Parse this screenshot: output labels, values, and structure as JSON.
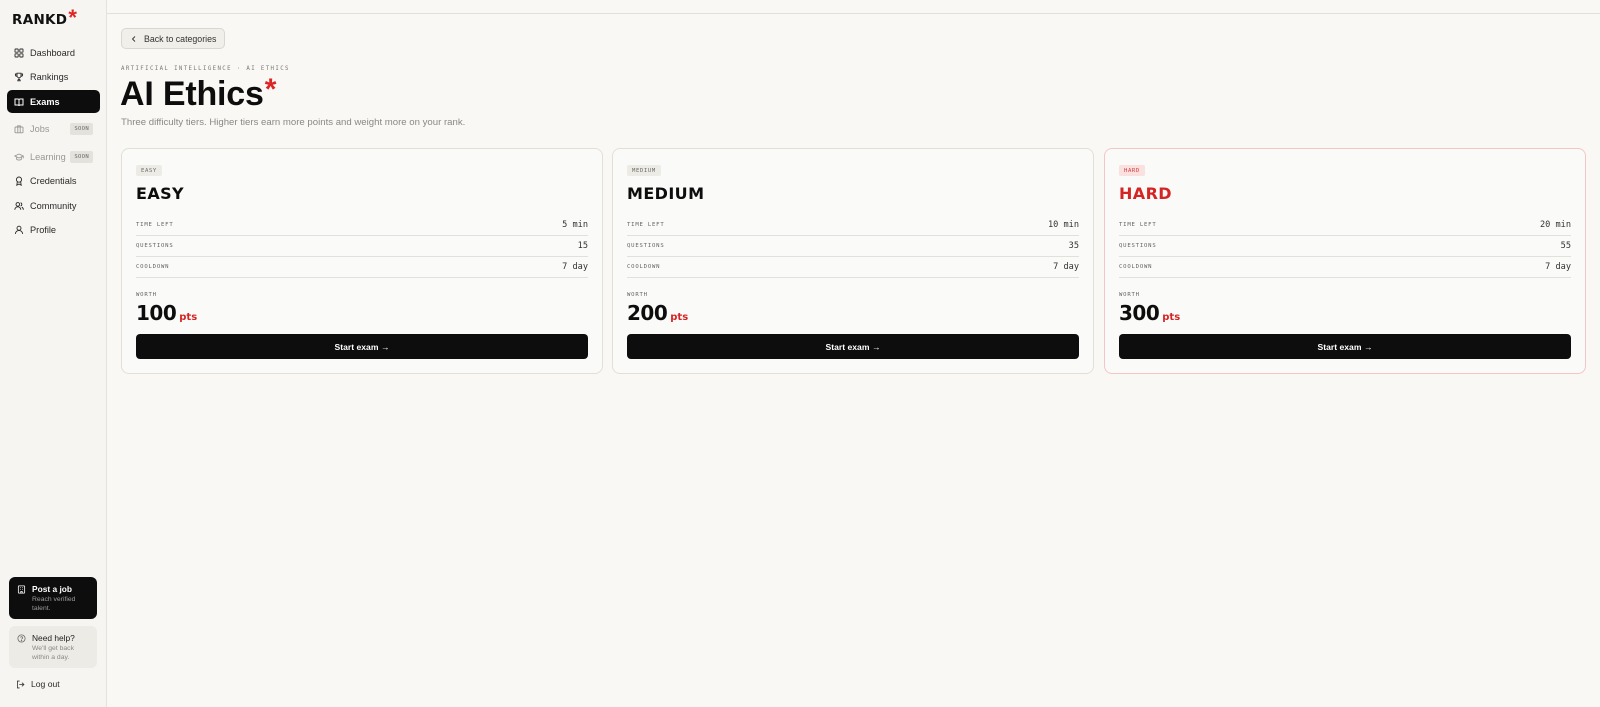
{
  "app": {
    "logo_text": "RANKD",
    "logo_mark": "*"
  },
  "sidebar": {
    "items": [
      {
        "label": "Dashboard",
        "icon": "grid-icon"
      },
      {
        "label": "Rankings",
        "icon": "trophy-icon"
      },
      {
        "label": "Exams",
        "icon": "book-icon",
        "active": true
      },
      {
        "label": "Jobs",
        "icon": "briefcase-icon",
        "badge": "SOON",
        "disabled": true
      },
      {
        "label": "Learning",
        "icon": "graduation-cap-icon",
        "badge": "SOON",
        "disabled": true
      },
      {
        "label": "Credentials",
        "icon": "award-icon"
      },
      {
        "label": "Community",
        "icon": "users-icon"
      },
      {
        "label": "Profile",
        "icon": "user-icon"
      }
    ],
    "post_job": {
      "title": "Post a job",
      "subtitle": "Reach verified talent."
    },
    "help": {
      "title": "Need help?",
      "subtitle": "We'll get back within a day."
    },
    "logout_label": "Log out"
  },
  "main": {
    "back_label": "Back to categories",
    "breadcrumb": "ARTIFICIAL INTELLIGENCE · AI ETHICS",
    "title": "AI Ethics",
    "title_mark": "*",
    "subtitle": "Three difficulty tiers. Higher tiers earn more points and weight more on your rank.",
    "row_labels": {
      "time": "TIME LEFT",
      "questions": "QUESTIONS",
      "cooldown": "COOLDOWN",
      "worth": "WORTH"
    },
    "tiers": [
      {
        "badge": "EASY",
        "name": "EASY",
        "time": "5 min",
        "questions": "15",
        "cooldown": "7 day",
        "worth": "100",
        "unit": "pts",
        "cta": "Start exam →"
      },
      {
        "badge": "MEDIUM",
        "name": "MEDIUM",
        "time": "10 min",
        "questions": "35",
        "cooldown": "7 day",
        "worth": "200",
        "unit": "pts",
        "cta": "Start exam →"
      },
      {
        "badge": "HARD",
        "name": "HARD",
        "time": "20 min",
        "questions": "55",
        "cooldown": "7 day",
        "worth": "300",
        "unit": "pts",
        "cta": "Start exam →"
      }
    ]
  },
  "colors": {
    "accent": "#dc2626",
    "primary": "#0d0d0d",
    "background": "#f9f8f5"
  }
}
